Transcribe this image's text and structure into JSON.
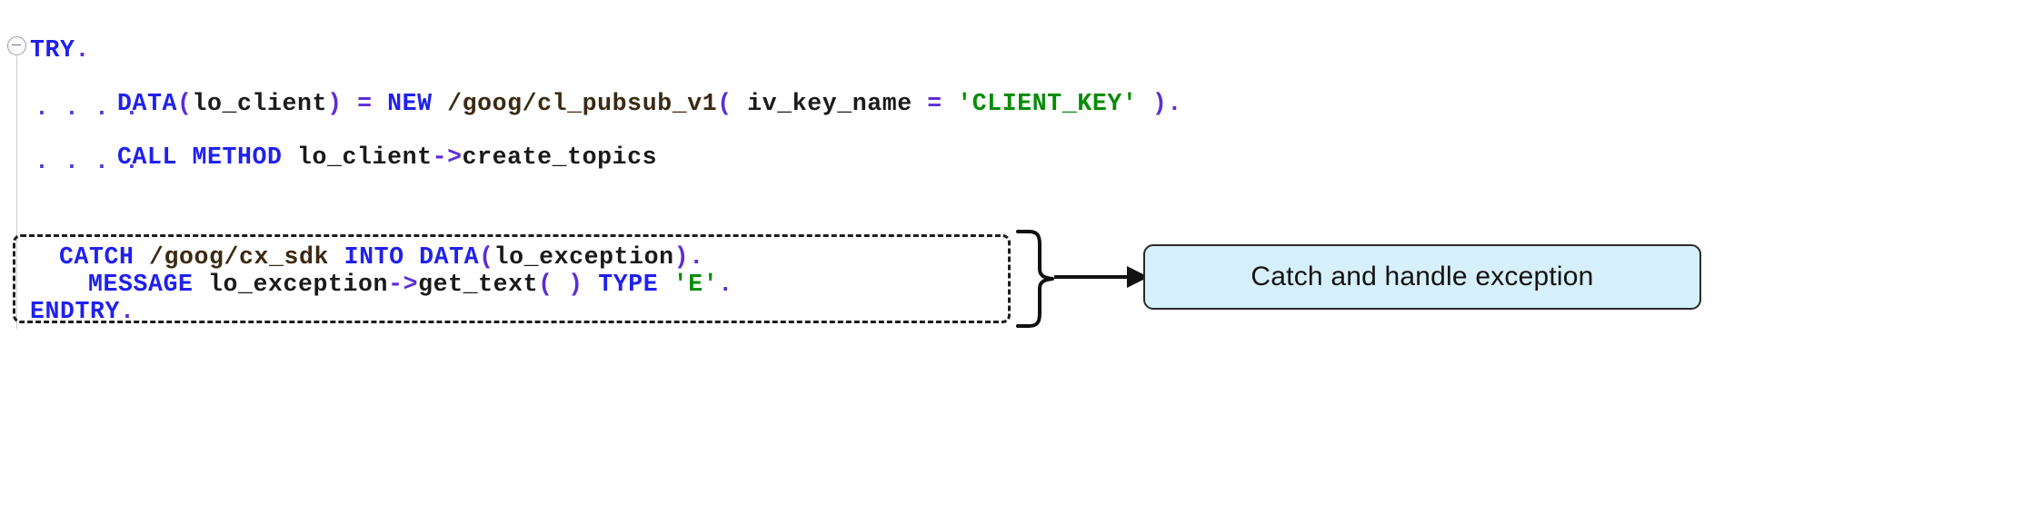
{
  "editor": {
    "language": "ABAP",
    "fold_icon": "collapse-minus-icon",
    "continuation_marker": ". . . .",
    "lines": [
      {
        "id": "line-try",
        "indent": 0,
        "tokens": [
          {
            "text": "TRY",
            "type": "kw"
          },
          {
            "text": ".",
            "type": "op"
          }
        ]
      },
      {
        "id": "line-data-client",
        "indent": 3,
        "tokens": [
          {
            "text": "DATA",
            "type": "kw"
          },
          {
            "text": "(",
            "type": "op"
          },
          {
            "text": "lo_client",
            "type": "id"
          },
          {
            "text": ")",
            "type": "op"
          },
          {
            "text": " ",
            "type": "id"
          },
          {
            "text": "=",
            "type": "op"
          },
          {
            "text": " ",
            "type": "id"
          },
          {
            "text": "NEW",
            "type": "kw"
          },
          {
            "text": " ",
            "type": "id"
          },
          {
            "text": "/goog/cl_pubsub_v1",
            "type": "path"
          },
          {
            "text": "(",
            "type": "op"
          },
          {
            "text": " iv_key_name ",
            "type": "id"
          },
          {
            "text": "=",
            "type": "op"
          },
          {
            "text": " ",
            "type": "id"
          },
          {
            "text": "'CLIENT_KEY'",
            "type": "str"
          },
          {
            "text": " ",
            "type": "id"
          },
          {
            "text": ")",
            "type": "op"
          },
          {
            "text": ".",
            "type": "op"
          }
        ]
      },
      {
        "id": "line-call-method",
        "indent": 3,
        "tokens": [
          {
            "text": "CALL",
            "type": "kw"
          },
          {
            "text": " ",
            "type": "id"
          },
          {
            "text": "METHOD",
            "type": "kw"
          },
          {
            "text": " lo_client",
            "type": "id"
          },
          {
            "text": "->",
            "type": "op"
          },
          {
            "text": "create_topics",
            "type": "id"
          }
        ]
      },
      {
        "id": "line-catch",
        "indent": 1,
        "tokens": [
          {
            "text": "CATCH",
            "type": "kw"
          },
          {
            "text": " ",
            "type": "id"
          },
          {
            "text": "/goog/cx_sdk",
            "type": "path"
          },
          {
            "text": " ",
            "type": "id"
          },
          {
            "text": "INTO",
            "type": "kw"
          },
          {
            "text": " ",
            "type": "id"
          },
          {
            "text": "DATA",
            "type": "kw"
          },
          {
            "text": "(",
            "type": "op"
          },
          {
            "text": "lo_exception",
            "type": "id"
          },
          {
            "text": ")",
            "type": "op"
          },
          {
            "text": ".",
            "type": "op"
          }
        ]
      },
      {
        "id": "line-message",
        "indent": 2,
        "tokens": [
          {
            "text": "MESSAGE",
            "type": "kw"
          },
          {
            "text": " lo_exception",
            "type": "id"
          },
          {
            "text": "->",
            "type": "op"
          },
          {
            "text": "get_text",
            "type": "id"
          },
          {
            "text": "(",
            "type": "op"
          },
          {
            "text": " ",
            "type": "id"
          },
          {
            "text": ")",
            "type": "op"
          },
          {
            "text": " ",
            "type": "id"
          },
          {
            "text": "TYPE",
            "type": "kw"
          },
          {
            "text": " ",
            "type": "id"
          },
          {
            "text": "'E'",
            "type": "str"
          },
          {
            "text": ".",
            "type": "op"
          }
        ]
      },
      {
        "id": "line-endtry",
        "indent": 0,
        "tokens": [
          {
            "text": "ENDTRY",
            "type": "kw"
          },
          {
            "text": ".",
            "type": "op"
          }
        ]
      }
    ]
  },
  "annotation": {
    "callout_label": "Catch and handle exception",
    "callout_fill": "#d6f0fb",
    "callout_border": "#2a2a2a",
    "highlight_border": "#1d1d1d",
    "connector": "curly-brace-and-arrow"
  },
  "colors": {
    "keyword": "#2020ee",
    "string": "#068d06",
    "operator": "#5b2ed6",
    "identifier": "#1a1a1a",
    "namespace_path": "#3a2a12",
    "background": "#ffffff"
  }
}
